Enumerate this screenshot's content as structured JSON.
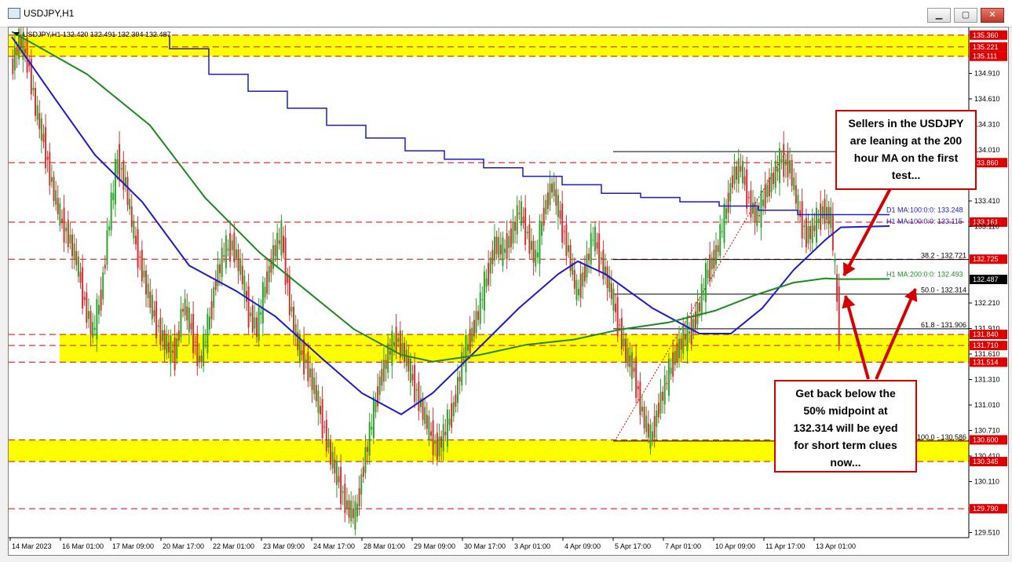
{
  "window": {
    "title": "USDJPY,H1",
    "minimize": "▁",
    "maximize": "▢",
    "close": "✕"
  },
  "chart_data": {
    "type": "line",
    "header": "USDJPY,H1  132.420 132.491 132.394 132.487",
    "y_ticks": [
      "135.360",
      "135.221",
      "135.111",
      "134.910",
      "134.610",
      "134.310",
      "134.010",
      "133.860",
      "133.410",
      "133.161",
      "133.110",
      "132.725",
      "132.487",
      "132.210",
      "131.910",
      "131.840",
      "131.710",
      "131.610",
      "131.514",
      "131.310",
      "131.010",
      "130.710",
      "130.600",
      "130.410",
      "130.345",
      "130.110",
      "129.790",
      "129.510"
    ],
    "x_ticks": [
      "14 Mar 2023",
      "16 Mar 01:00",
      "17 Mar 09:00",
      "20 Mar 17:00",
      "22 Mar 01:00",
      "23 Mar 09:00",
      "24 Mar 17:00",
      "28 Mar 01:00",
      "29 Mar 09:00",
      "30 Mar 17:00",
      "3 Apr 01:00",
      "4 Apr 09:00",
      "5 Apr 17:00",
      "7 Apr 01:00",
      "10 Apr 09:00",
      "11 Apr 17:00",
      "13 Apr 01:00"
    ],
    "ylim": [
      129.45,
      135.45
    ],
    "current_price": "132.487",
    "levels": [
      135.36,
      135.221,
      135.111,
      133.86,
      133.161,
      132.725,
      131.84,
      131.71,
      131.514,
      130.6,
      130.345,
      129.79
    ],
    "zones": [
      [
        135.111,
        135.36
      ],
      [
        131.514,
        131.84
      ],
      [
        130.345,
        130.6
      ]
    ],
    "fib_labels": [
      "38.2 - 132.721",
      "50.0 - 132.314",
      "61.8 - 131.906",
      "100.0 - 130.586"
    ],
    "fib_values": [
      133.99,
      132.721,
      132.314,
      131.906,
      130.586
    ],
    "ma_labels": {
      "d1": "D1 MA:100:0:0: 133.248",
      "h1_100": "H1 MA:100:0:0: 133.115",
      "h1_200": "H1 MA:200:0:0: 132.493"
    },
    "price_series": [
      134.95,
      135.3,
      135.1,
      134.5,
      134.1,
      133.6,
      133.2,
      133.0,
      132.7,
      132.2,
      131.85,
      132.3,
      133.2,
      133.9,
      133.6,
      133.0,
      132.6,
      132.2,
      131.9,
      131.7,
      131.6,
      132.2,
      131.9,
      131.5,
      131.9,
      132.5,
      132.8,
      132.9,
      132.6,
      132.1,
      131.9,
      132.4,
      132.8,
      133.0,
      132.2,
      131.7,
      131.5,
      131.2,
      130.8,
      130.4,
      130.1,
      129.8,
      129.7,
      130.3,
      130.8,
      131.3,
      131.6,
      131.8,
      131.6,
      131.3,
      131.0,
      130.7,
      130.5,
      130.7,
      131.0,
      131.5,
      131.8,
      132.1,
      132.5,
      132.9,
      132.8,
      133.0,
      133.3,
      133.0,
      132.7,
      133.3,
      133.6,
      133.2,
      132.8,
      132.3,
      132.6,
      133.0,
      132.7,
      132.4,
      132.0,
      131.6,
      131.4,
      130.9,
      130.6,
      131.0,
      131.3,
      131.6,
      131.8,
      131.9,
      132.2,
      132.6,
      132.8,
      133.2,
      133.7,
      133.8,
      133.4,
      133.2,
      133.5,
      133.7,
      133.9,
      133.8,
      133.3,
      133.0,
      133.1,
      133.3,
      133.2,
      131.9
    ]
  },
  "annotations": {
    "box1": [
      "Sellers in the USDJPY",
      "are leaning at the 200",
      "hour MA on the first",
      "test..."
    ],
    "box2": [
      "Get back below the",
      "50% midpoint at",
      "132.314 will be eyed",
      "for short term clues",
      "now..."
    ]
  },
  "colors": {
    "level": "#e00000",
    "zone": "#ffff00",
    "ma_blue": "#1a1ad0",
    "ma_green": "#1e8a1e",
    "candle_up": "#2aa52a",
    "candle_down": "#d23232",
    "annot_border": "#d40000"
  }
}
